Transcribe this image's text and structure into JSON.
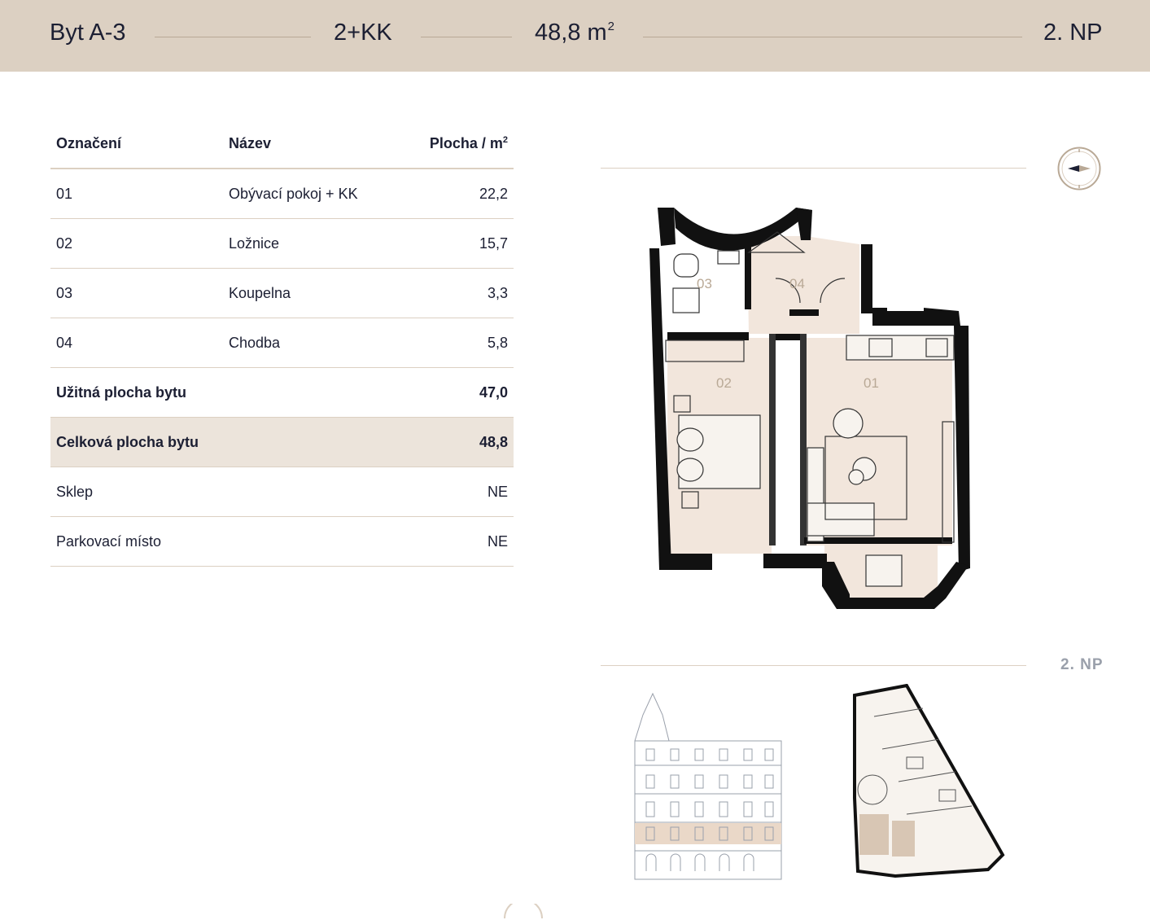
{
  "header": {
    "unit": "Byt A-3",
    "layout": "2+KK",
    "area_value": "48,8 m",
    "area_sup": "2",
    "floor": "2. NP"
  },
  "table": {
    "headers": {
      "code": "Označení",
      "name": "Název",
      "area": "Plocha / m",
      "area_sup": "2"
    },
    "rows": [
      {
        "code": "01",
        "name": "Obývací pokoj + KK",
        "area": "22,2"
      },
      {
        "code": "02",
        "name": "Ložnice",
        "area": "15,7"
      },
      {
        "code": "03",
        "name": "Koupelna",
        "area": "3,3"
      },
      {
        "code": "04",
        "name": "Chodba",
        "area": "5,8"
      }
    ],
    "usable": {
      "label": "Užitná plocha bytu",
      "value": "47,0"
    },
    "total": {
      "label": "Celková plocha bytu",
      "value": "48,8"
    },
    "cellar": {
      "label": "Sklep",
      "value": "NE"
    },
    "parking": {
      "label": "Parkovací místo",
      "value": "NE"
    }
  },
  "plan": {
    "room_labels": [
      "03",
      "04",
      "02",
      "01"
    ]
  },
  "floor_label": "2. NP",
  "colors": {
    "header_bg": "#dcd0c2",
    "accent": "#b9a996",
    "room_fill": "#f2e6dc",
    "total_row_bg": "#ece4db",
    "text": "#1c1f33"
  }
}
